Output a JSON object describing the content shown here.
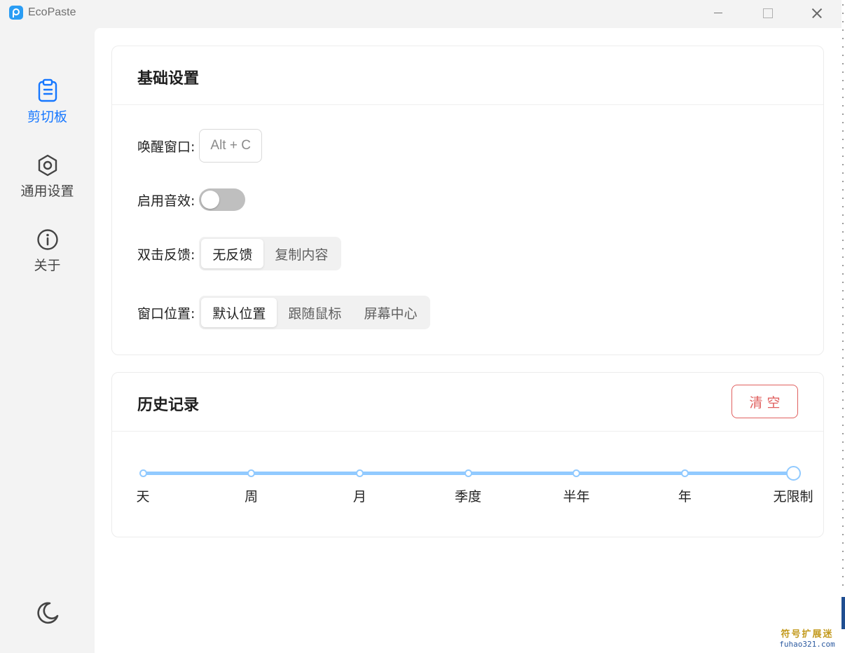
{
  "window": {
    "title": "EcoPaste"
  },
  "sidebar": {
    "items": [
      {
        "label": "剪切板",
        "icon": "clipboard-icon",
        "active": true
      },
      {
        "label": "通用设置",
        "icon": "settings-icon",
        "active": false
      },
      {
        "label": "关于",
        "icon": "info-icon",
        "active": false
      }
    ],
    "theme_icon": "moon-icon"
  },
  "basic_settings": {
    "title": "基础设置",
    "wake_label": "唤醒窗口:",
    "wake_hotkey": "Alt + C",
    "sound_label": "启用音效:",
    "sound_enabled": false,
    "double_click_label": "双击反馈:",
    "double_click_options": [
      "无反馈",
      "复制内容"
    ],
    "double_click_selected": "无反馈",
    "position_label": "窗口位置:",
    "position_options": [
      "默认位置",
      "跟随鼠标",
      "屏幕中心"
    ],
    "position_selected": "默认位置"
  },
  "history": {
    "title": "历史记录",
    "clear_label": "清空",
    "duration_marks": [
      "天",
      "周",
      "月",
      "季度",
      "半年",
      "年",
      "无限制"
    ],
    "duration_selected": "无限制"
  },
  "watermark": {
    "line1": "符号扩展迷",
    "line2": "fuhao321.com"
  },
  "colors": {
    "accent": "#1677ff",
    "danger": "#e0605f",
    "slider": "#91caff"
  }
}
